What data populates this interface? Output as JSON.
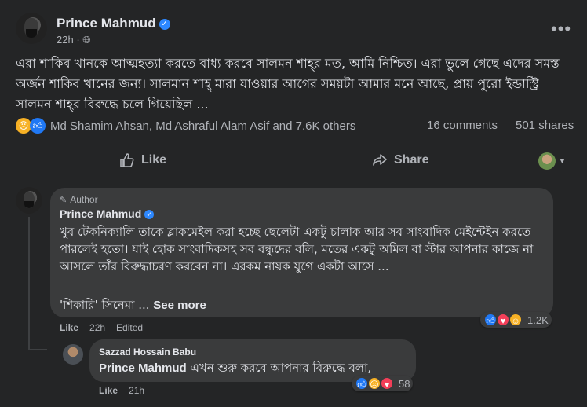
{
  "post": {
    "author": "Prince Mahmud",
    "time": "22h",
    "privacy_icon": "globe-icon",
    "more_icon": "ellipsis-icon",
    "text": "এরা শাকিব খানকে আত্মহত্যা করতে বাধ্য করবে সালমন শাহ্‌র মত, আমি নিশ্চিত। এরা ভুলে গেছে এদের সমস্ত অর্জন শাকিব খানের জন্য। সালমান শাহ্‌ মারা যাওয়ার আগের সময়টা আমার মনে আছে, প্রায় পুরো ইন্ডাস্ট্রি সালমন শাহ্‌র বিরুদ্ধে চলে গিয়েছিল ...",
    "reactions_text": "Md Shamim Ahsan, Md Ashraful Alam Asif and 7.6K others",
    "comments_count": "16 comments",
    "shares_count": "501 shares"
  },
  "actions": {
    "like_label": "Like",
    "share_label": "Share"
  },
  "comment1": {
    "badge": "Author",
    "author": "Prince Mahmud",
    "text": "খুব টেকনিক্যালি তাকে ব্লাকমেইল করা হচ্ছে ছেলেটা একটু চালাক আর সব সাংবাদিক মেইন্টেইন করতে পারলেই হতো। যাই হোক সাংবাদিকসহ সব বন্ধুদের বলি, মতের একটু অমিল বা স্টার আপনার কাজে না আসলে তাঁর বিরুদ্ধাচরণ করবেন না। এরকম নায়ক যুগে একটা আসে ...",
    "text2": "'শিকারি' সিনেমা ...",
    "see_more": "See more",
    "like": "Like",
    "time": "22h",
    "edited": "Edited",
    "reaction_count": "1.2K"
  },
  "comment2": {
    "author": "Sazzad Hossain Babu",
    "mention": "Prince Mahmud",
    "text": " এখন শুরু করবে আপনার বিরুদ্ধে বলা,",
    "like": "Like",
    "time": "21h",
    "reaction_count": "58"
  },
  "colors": {
    "background": "#242526",
    "bubble": "#3a3b3c",
    "verified": "#2d88ff",
    "text": "#e4e6eb",
    "muted": "#b0b3b8"
  }
}
